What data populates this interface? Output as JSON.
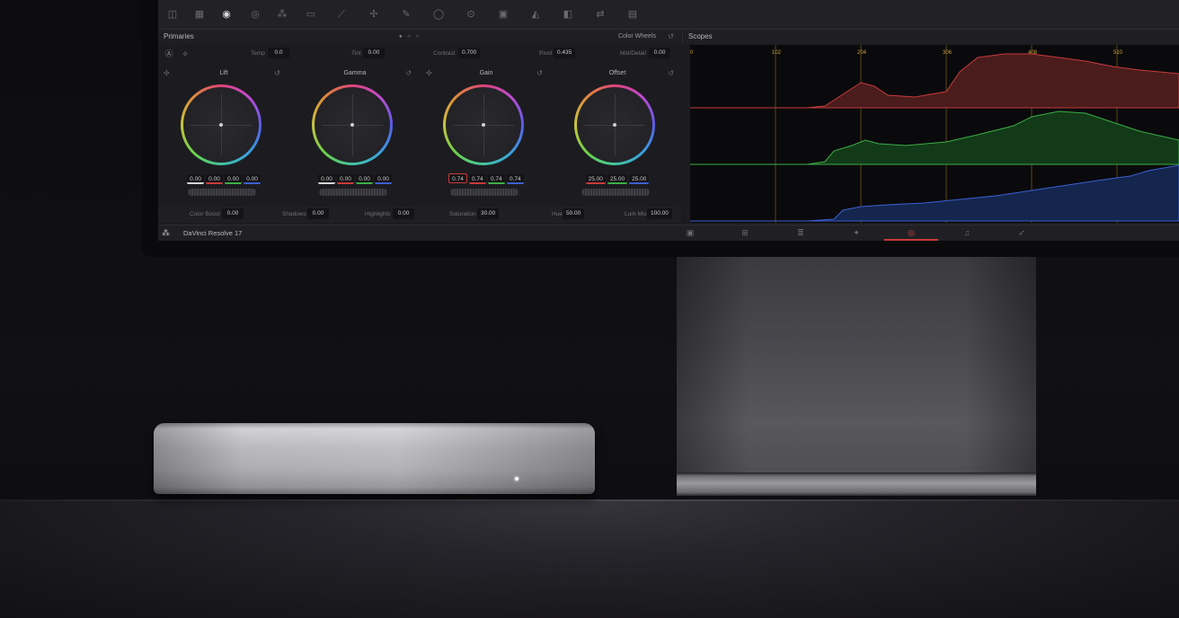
{
  "app": {
    "name": "DaVinci Resolve 17",
    "top_right_text": "DaVinci Resolve 17"
  },
  "toolbar": {
    "icons": [
      "camera-raw-icon",
      "color-match-icon",
      "primaries-icon",
      "hdr-icon",
      "rgb-mixer-icon",
      "motion-icon",
      "curves-icon",
      "color-warper-icon",
      "qualifier-icon",
      "window-icon",
      "tracker-icon",
      "magic-mask-icon",
      "blur-icon",
      "key-icon",
      "sizing-icon",
      "3d-icon"
    ]
  },
  "primaries": {
    "title": "Primaries",
    "mode": "Color Wheels",
    "adjust": {
      "temp_label": "Temp",
      "temp": "0.0",
      "tint_label": "Tint",
      "tint": "0.00",
      "contrast_label": "Contrast",
      "contrast": "0.700",
      "pivot_label": "Pivot",
      "pivot": "0.435",
      "middetail_label": "Mid/Detail",
      "middetail": "0.00"
    },
    "wheels": [
      {
        "label": "Lift",
        "values": [
          "0.00",
          "0.00",
          "0.00",
          "0.00"
        ]
      },
      {
        "label": "Gamma",
        "values": [
          "0.00",
          "0.00",
          "0.00",
          "0.00"
        ]
      },
      {
        "label": "Gain",
        "values": [
          "0.74",
          "0.74",
          "0.74",
          "0.74"
        ]
      },
      {
        "label": "Offset",
        "values": [
          "25.00",
          "25.00",
          "25.00"
        ]
      }
    ],
    "bottom": {
      "color_boost_label": "Color Boost",
      "color_boost": "0.00",
      "shadows_label": "Shadows",
      "shadows": "0.00",
      "highlights_label": "Highlights",
      "highlights": "0.00",
      "saturation_label": "Saturation",
      "saturation": "30.00",
      "hue_label": "Hue",
      "hue": "50.00",
      "lum_mix_label": "Lum Mix",
      "lum_mix": "100.00"
    }
  },
  "scopes": {
    "title": "Scopes",
    "axis_labels": [
      "0",
      "102",
      "204",
      "306",
      "408",
      "510"
    ],
    "colors": {
      "red": "#c73b3b",
      "green": "#3cae47",
      "blue": "#3d5fd0",
      "guide": "#8a6a1c"
    }
  },
  "pages": [
    "media-page-icon",
    "cut-page-icon",
    "edit-page-icon",
    "fusion-page-icon",
    "color-page-icon",
    "fairlight-page-icon",
    "deliver-page-icon"
  ]
}
